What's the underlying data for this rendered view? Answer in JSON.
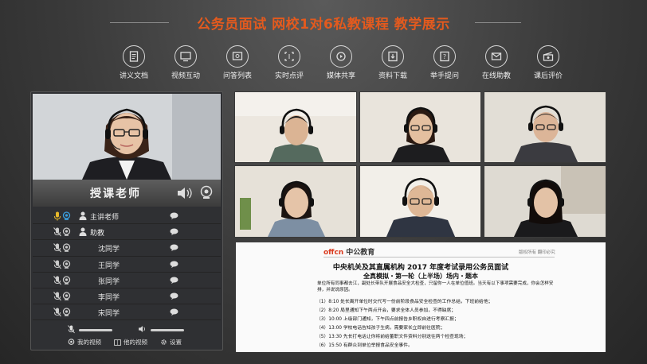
{
  "header": {
    "title": "公务员面试  网校1对6私教课程  教学展示"
  },
  "toolbar": [
    {
      "label": "讲义文档",
      "icon": "document-icon"
    },
    {
      "label": "视频互动",
      "icon": "monitor-icon"
    },
    {
      "label": "问答列表",
      "icon": "qa-list-icon"
    },
    {
      "label": "实时点评",
      "icon": "comment-frame-icon"
    },
    {
      "label": "媒体共享",
      "icon": "media-share-icon"
    },
    {
      "label": "资料下载",
      "icon": "download-icon"
    },
    {
      "label": "举手提问",
      "icon": "raise-hand-icon"
    },
    {
      "label": "在线助教",
      "icon": "mail-icon"
    },
    {
      "label": "课后评价",
      "icon": "clapper-icon"
    }
  ],
  "instructor": {
    "label": "授课老师"
  },
  "participants": [
    {
      "name": "主讲老师",
      "mic_on": true,
      "cam_on": true
    },
    {
      "name": "助教",
      "mic_on": false,
      "cam_on": false
    },
    {
      "name": "沈同学",
      "mic_on": false,
      "cam_on": false
    },
    {
      "name": "王同学",
      "mic_on": false,
      "cam_on": false
    },
    {
      "name": "张同学",
      "mic_on": false,
      "cam_on": false
    },
    {
      "name": "李同学",
      "mic_on": false,
      "cam_on": false
    },
    {
      "name": "宋同学",
      "mic_on": false,
      "cam_on": false
    }
  ],
  "controls": {
    "my_video": "我的视频",
    "his_video": "他的视频",
    "settings": "设置"
  },
  "document": {
    "logo_text": "offcn",
    "brand": "中公教育",
    "top_right": "版权所有  翻印必究",
    "title": "中央机关及其直属机构 2017 年度考试录用公务员面试",
    "subtitle": "全真模拟・第一轮（上半场）场内・题本",
    "intro": "单位所有同事都去江，副处长带队开展食品安全大检查，只留你一人在单位值班。当天有以下事项需要完成，你会怎样安排，并说说原因。",
    "items": [
      "（1）8:10 处长离开单位时交代写一份前阶段食品安全检查的工作总结，下班前给他；",
      "（2）8:20 局里通知下午两点开会，要求全体人员参加，不得缺席；",
      "（3）10:00 上级部门通知，下午四点前报告乡职权自进行考察汇报；",
      "（4）13:00 学校电话告知孩子生病，需要家长立即前往医院；",
      "（5）13:30 先长打电话让你将前给董职文件资料分别送往两个检查现场；",
      "（6）15:50 有群众到单位举报食品安全事件。"
    ]
  },
  "colors": {
    "accent": "#e35a1e",
    "panel": "#2f3033",
    "doc_logo": "#d93a1e"
  }
}
